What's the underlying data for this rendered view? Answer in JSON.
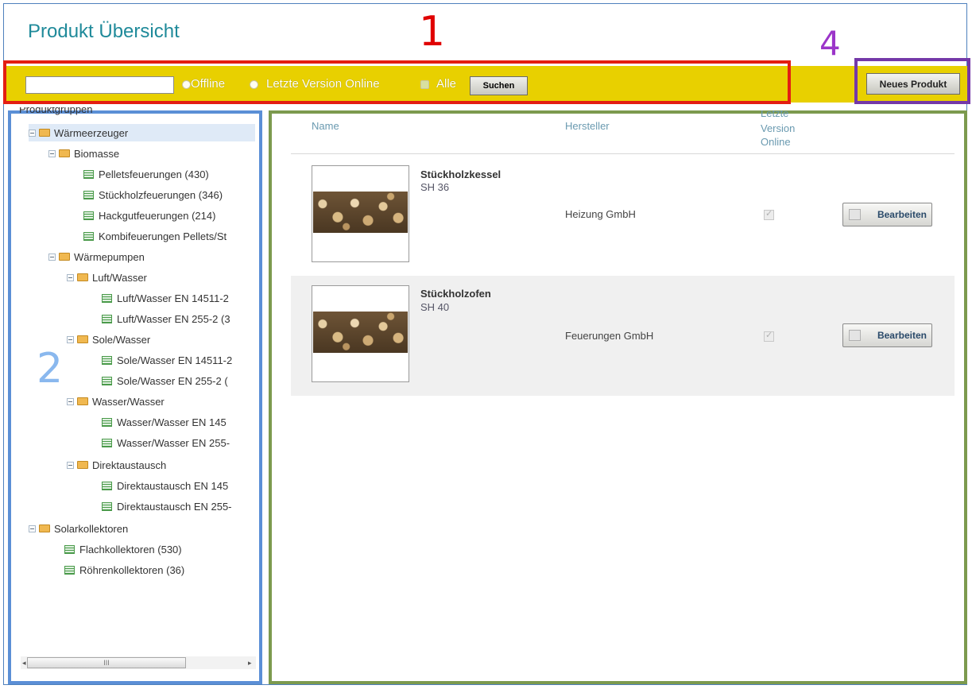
{
  "page": {
    "title": "Produkt Übersicht"
  },
  "annotations": {
    "one": "1",
    "two": "2",
    "four": "4"
  },
  "search": {
    "value": "",
    "placeholder": "",
    "button": "Suchen"
  },
  "filters": [
    {
      "label": "Offline"
    },
    {
      "label": "Letzte Version Online"
    },
    {
      "label": "Alle"
    }
  ],
  "new_product_button": "Neues Produkt",
  "tree": {
    "root": "Produktgruppen",
    "items": [
      {
        "label": "Wärmeerzeuger"
      },
      {
        "label": "Biomasse"
      },
      {
        "label": "Pelletsfeuerungen (430)"
      },
      {
        "label": "Stückholzfeuerungen (346)"
      },
      {
        "label": "Hackgutfeuerungen (214)"
      },
      {
        "label": "Kombifeuerungen Pellets/St"
      },
      {
        "label": "Wärmepumpen"
      },
      {
        "label": "Luft/Wasser"
      },
      {
        "label": "Luft/Wasser EN 14511-2"
      },
      {
        "label": "Luft/Wasser EN 255-2 (3"
      },
      {
        "label": "Sole/Wasser"
      },
      {
        "label": "Sole/Wasser EN 14511-2"
      },
      {
        "label": "Sole/Wasser EN 255-2 ("
      },
      {
        "label": "Wasser/Wasser"
      },
      {
        "label": "Wasser/Wasser EN 145"
      },
      {
        "label": "Wasser/Wasser EN 255-"
      },
      {
        "label": "Direktaustausch"
      },
      {
        "label": "Direktaustausch EN 145"
      },
      {
        "label": "Direktaustausch EN 255-"
      },
      {
        "label": "Solarkollektoren"
      },
      {
        "label": "Flachkollektoren (530)"
      },
      {
        "label": "Röhrenkollektoren (36)"
      }
    ],
    "scrollbar": {
      "left": "◂",
      "thumb": "III",
      "right": "▸"
    }
  },
  "table": {
    "headers": {
      "name": "Name",
      "maker": "Hersteller",
      "online_1": "Letzte",
      "online_2": "Version",
      "online_3": "Online"
    },
    "rows": [
      {
        "name": "Stückholzkessel",
        "model": "SH 36",
        "maker": "Heizung GmbH",
        "online": true,
        "action": "Bearbeiten"
      },
      {
        "name": "Stückholzofen",
        "model": "SH 40",
        "maker": "Feuerungen GmbH",
        "online": true,
        "action": "Bearbeiten"
      }
    ]
  },
  "colors": {
    "toolbar": "#e8d000",
    "title": "#1f8a9a",
    "box1": "#e31e12",
    "box2": "#5b8fd6",
    "box3": "#7c9a4e",
    "box4": "#7438a8"
  }
}
